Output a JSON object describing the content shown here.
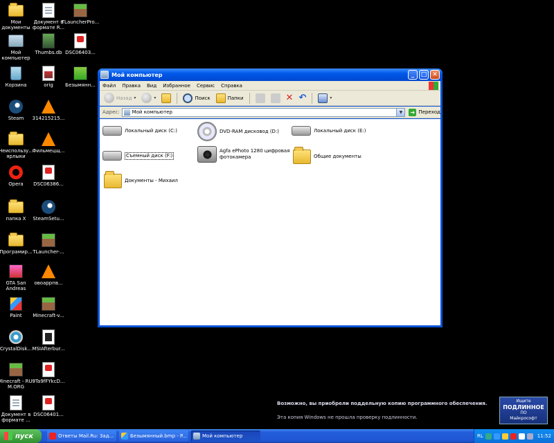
{
  "desktop": {
    "icons": [
      {
        "label": "Мои документы"
      },
      {
        "label": "Документ в формате R..."
      },
      {
        "label": "TLauncherPro..."
      },
      {
        "label": "Мой компьютер"
      },
      {
        "label": "Thumbs.db"
      },
      {
        "label": "DSC06403..."
      },
      {
        "label": "Корзина"
      },
      {
        "label": "orig"
      },
      {
        "label": "Безымянн..."
      },
      {
        "label": "Steam"
      },
      {
        "label": "314215215..."
      },
      {
        "label": "Неиспользу... ярлыки"
      },
      {
        "label": "Фильмецщ..."
      },
      {
        "label": "Opera"
      },
      {
        "label": "DSC06386..."
      },
      {
        "label": "папка X"
      },
      {
        "label": "SteamSetu..."
      },
      {
        "label": "Програмир..."
      },
      {
        "label": "TLauncher-..."
      },
      {
        "label": "GTA San Andreas"
      },
      {
        "label": "овоаррпв..."
      },
      {
        "label": "Paint"
      },
      {
        "label": "Minecraft-v..."
      },
      {
        "label": "CrystalDisk..."
      },
      {
        "label": "MSIAfterbur..."
      },
      {
        "label": "Minecraft - RU-M.ORG"
      },
      {
        "label": "9Ta9fFYkcD..."
      },
      {
        "label": "Документ в формате ..."
      },
      {
        "label": "DSC06401..."
      }
    ]
  },
  "window": {
    "title": "Мой компьютер",
    "controls": {
      "minimize": "_",
      "maximize": "□",
      "close": "✕"
    },
    "menu": [
      "Файл",
      "Правка",
      "Вид",
      "Избранное",
      "Сервис",
      "Справка"
    ],
    "toolbar": {
      "back": "Назад",
      "search": "Поиск",
      "folders": "Папки"
    },
    "address": {
      "label": "Адрес:",
      "value": "Мой компьютер",
      "go": "Переход"
    },
    "items": [
      {
        "label": "Локальный диск (C:)"
      },
      {
        "label": "DVD-RAM дисковод (D:)"
      },
      {
        "label": "Локальный диск (E:)"
      },
      {
        "label": "Съемный диск (F:)"
      },
      {
        "label": "Agfa ePhoto 1280 цифровая фотокамера"
      },
      {
        "label": "Общие документы"
      },
      {
        "label": "Документы - Михаил"
      }
    ]
  },
  "watermark": {
    "line1": "Возможно, вы приобрели поддельную копию программного обеспечения.",
    "line2": "Эта копия Windows не прошла проверку подлинности.",
    "badge_top": "Ищите",
    "badge_mid": "ПОДЛИННОЕ",
    "badge_small": "ПО",
    "badge_bottom": "Майкрософт"
  },
  "taskbar": {
    "start": "пуск",
    "tasks": [
      {
        "label": "Ответы Mail.Ru: Зад..."
      },
      {
        "label": "Безымянный.bmp - P..."
      },
      {
        "label": "Мой компьютер"
      }
    ],
    "tray": {
      "lang": "RL",
      "time": "11:52"
    }
  }
}
